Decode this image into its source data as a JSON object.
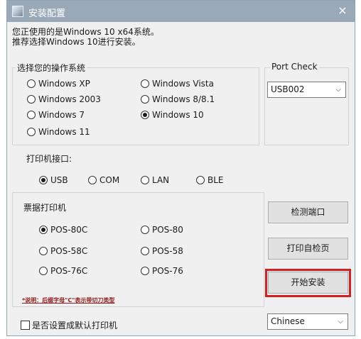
{
  "window": {
    "title": "安装配置",
    "close_glyph": "×"
  },
  "intro": {
    "line1": "您正使用的是Windows 10 x64系统。",
    "line2": "推荐选择Windows 10进行安装。"
  },
  "os_group": {
    "legend": "选择您的操作系统",
    "options": [
      {
        "label": "Windows XP",
        "selected": false
      },
      {
        "label": "Windows Vista",
        "selected": false
      },
      {
        "label": "Windows 2003",
        "selected": false
      },
      {
        "label": "Windows 8/8.1",
        "selected": false
      },
      {
        "label": "Windows 7",
        "selected": false
      },
      {
        "label": "Windows 10",
        "selected": true
      },
      {
        "label": "Windows 11",
        "selected": false
      }
    ]
  },
  "port_group": {
    "legend": "打印机接口:",
    "options": [
      {
        "label": "USB",
        "selected": true
      },
      {
        "label": "COM",
        "selected": false
      },
      {
        "label": "LAN",
        "selected": false
      },
      {
        "label": "BLE",
        "selected": false
      }
    ]
  },
  "printer_group": {
    "legend": "票据打印机",
    "options": [
      {
        "label": "POS-80C",
        "selected": true
      },
      {
        "label": "POS-80",
        "selected": false
      },
      {
        "label": "POS-58C",
        "selected": false
      },
      {
        "label": "POS-58",
        "selected": false
      },
      {
        "label": "POS-76C",
        "selected": false
      },
      {
        "label": "POS-76",
        "selected": false
      }
    ],
    "note": "*说明：后缀字母\"C\"表示带切刀类型"
  },
  "port_check": {
    "legend": "Port Check",
    "selected": "USB002"
  },
  "buttons": {
    "detect_port": "检测端口",
    "print_test": "打印自检页",
    "install": "开始安装"
  },
  "default_printer": {
    "label": "是否设置成默认打印机",
    "checked": false
  },
  "language": {
    "selected": "Chinese"
  },
  "colors": {
    "highlight": "#d32020",
    "titlebar": "#9aa9b8"
  }
}
